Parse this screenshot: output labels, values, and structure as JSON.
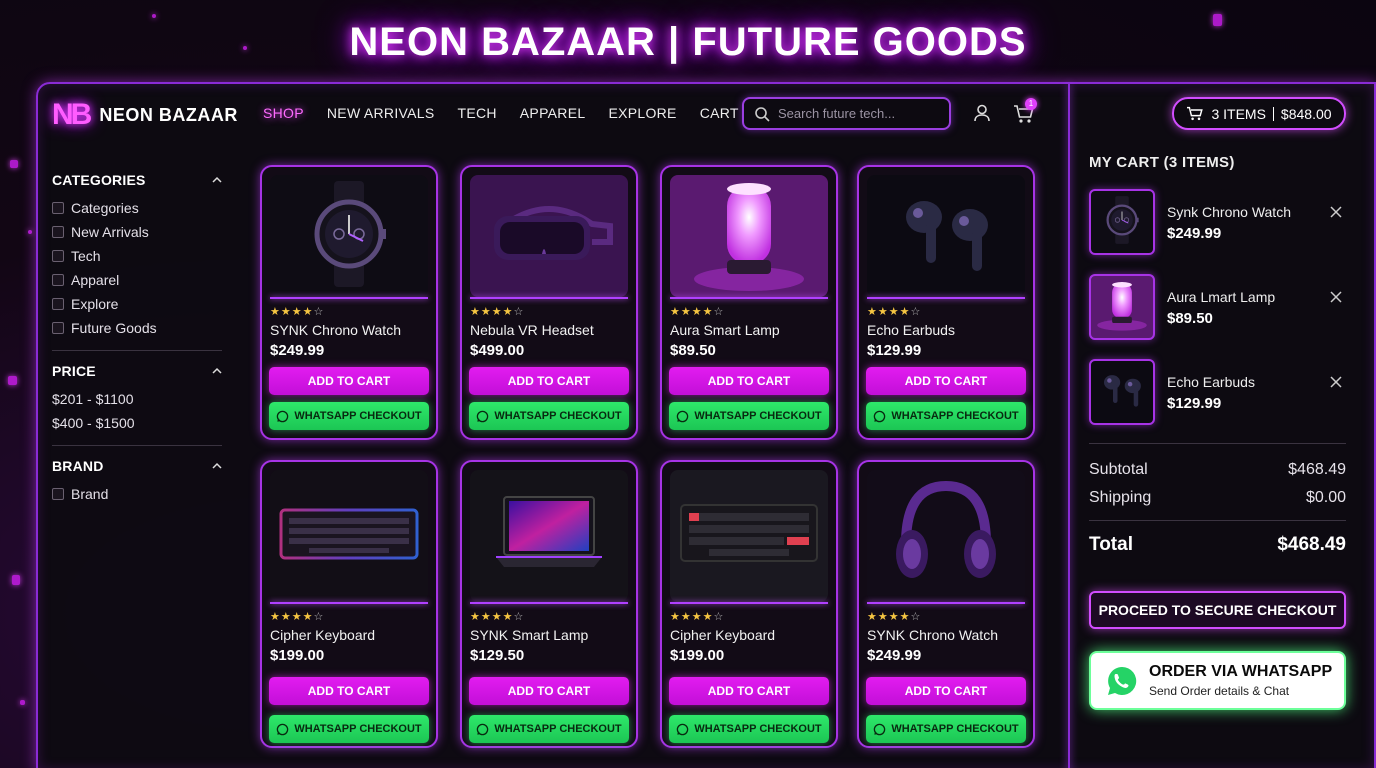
{
  "page_title": "NEON BAZAAR | FUTURE GOODS",
  "brand": {
    "mark": "NB",
    "name": "NEON BAZAAR"
  },
  "nav": [
    "SHOP",
    "NEW ARRIVALS",
    "TECH",
    "APPAREL",
    "EXPLORE",
    "CART"
  ],
  "search": {
    "placeholder": "Search future tech..."
  },
  "header_cart": {
    "badge": "1",
    "items": "3 ITEMS",
    "total": "$848.00"
  },
  "sidebar": {
    "categories": {
      "title": "CATEGORIES",
      "items": [
        "Categories",
        "New Arrivals",
        "Tech",
        "Apparel",
        "Explore",
        "Future Goods"
      ]
    },
    "price": {
      "title": "PRICE",
      "ranges": [
        "$201 - $1100",
        "$400 - $1500"
      ]
    },
    "brand": {
      "title": "BRAND",
      "items": [
        "Brand"
      ]
    }
  },
  "product_buttons": {
    "add_to_cart": "ADD TO CART",
    "whatsapp": "WHATSAPP CHECKOUT"
  },
  "products": [
    {
      "name": "SYNK Chrono Watch",
      "price": "$249.99",
      "rating": 4,
      "icon": "watch"
    },
    {
      "name": "Nebula VR Headset",
      "price": "$499.00",
      "rating": 4,
      "icon": "vr-headset"
    },
    {
      "name": "Aura Smart Lamp",
      "price": "$89.50",
      "rating": 4,
      "icon": "lamp"
    },
    {
      "name": "Echo Earbuds",
      "price": "$129.99",
      "rating": 4,
      "icon": "earbuds"
    },
    {
      "name": "Cipher Keyboard",
      "price": "$199.00",
      "rating": 4,
      "icon": "keyboard-rgb"
    },
    {
      "name": "SYNK Smart Lamp",
      "price": "$129.50",
      "rating": 4,
      "icon": "laptop"
    },
    {
      "name": "Cipher Keyboard",
      "price": "$199.00",
      "rating": 4,
      "icon": "keyboard-dark"
    },
    {
      "name": "SYNK Chrono Watch",
      "price": "$249.99",
      "rating": 4,
      "icon": "headphones"
    }
  ],
  "cart": {
    "title": "MY CART (3 ITEMS)",
    "items": [
      {
        "name": "Synk Chrono Watch",
        "price": "$249.99",
        "icon": "watch"
      },
      {
        "name": "Aura Lmart Lamp",
        "price": "$89.50",
        "icon": "lamp"
      },
      {
        "name": "Echo Earbuds",
        "price": "$129.99",
        "icon": "earbuds"
      }
    ],
    "subtotal_label": "Subtotal",
    "subtotal": "$468.49",
    "shipping_label": "Shipping",
    "shipping": "$0.00",
    "total_label": "Total",
    "total": "$468.49",
    "checkout_label": "PROCEED TO SECURE CHECKOUT",
    "whatsapp_title": "ORDER VIA WHATSAPP",
    "whatsapp_sub": "Send Order details & Chat"
  },
  "colors": {
    "neon_purple": "#d24dff",
    "add_to_cart": "#e21cf0",
    "whatsapp": "#2ee86a",
    "background": "#0b0510"
  }
}
